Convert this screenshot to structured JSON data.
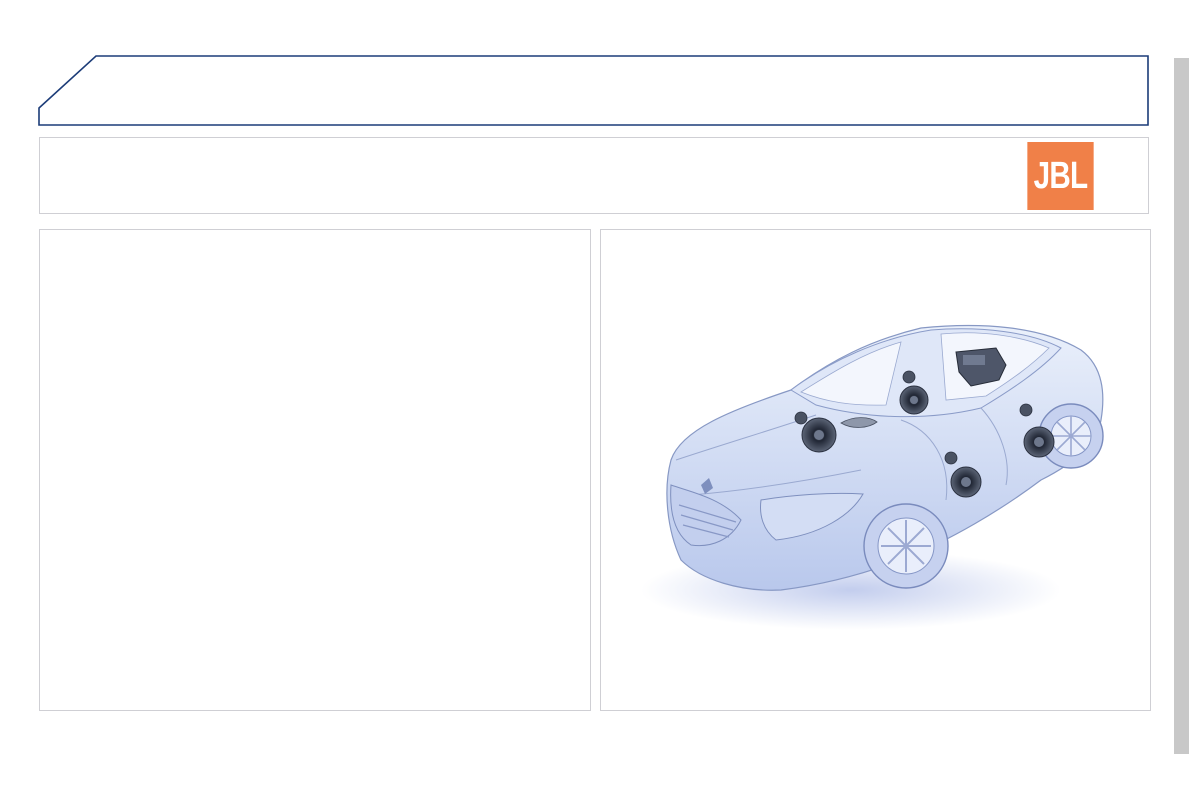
{
  "header": {
    "title": ""
  },
  "brand": {
    "logo_text": "JBL",
    "logo_color": "#f08048",
    "outline_color": "#1c3c78"
  },
  "left_panel": {
    "text": ""
  },
  "right_panel": {
    "illustration": "car-speaker-layout"
  },
  "icons": {
    "logo": "jbl-logo",
    "illustration": "car-cutaway-illustration"
  }
}
